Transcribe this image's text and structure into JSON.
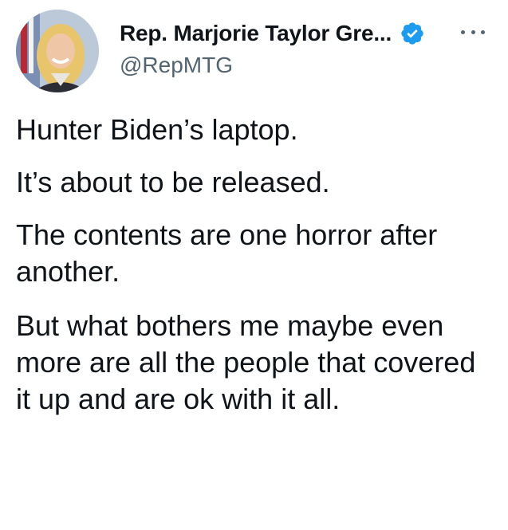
{
  "author": {
    "display_name": "Rep. Marjorie Taylor Gre...",
    "handle": "@RepMTG",
    "verified_icon": "verified-badge-icon",
    "avatar_icon": "profile-avatar",
    "more_icon": "more-options-icon"
  },
  "tweet": {
    "paragraphs": [
      "Hunter Biden’s laptop.",
      "It’s about to be released.",
      "The contents are one horror after another.",
      "But what bothers me maybe even more are all the people that covered it up and are ok with it all."
    ]
  },
  "colors": {
    "text": "#0f1419",
    "secondary_text": "#536471",
    "verified_blue": "#1d9bf0"
  }
}
